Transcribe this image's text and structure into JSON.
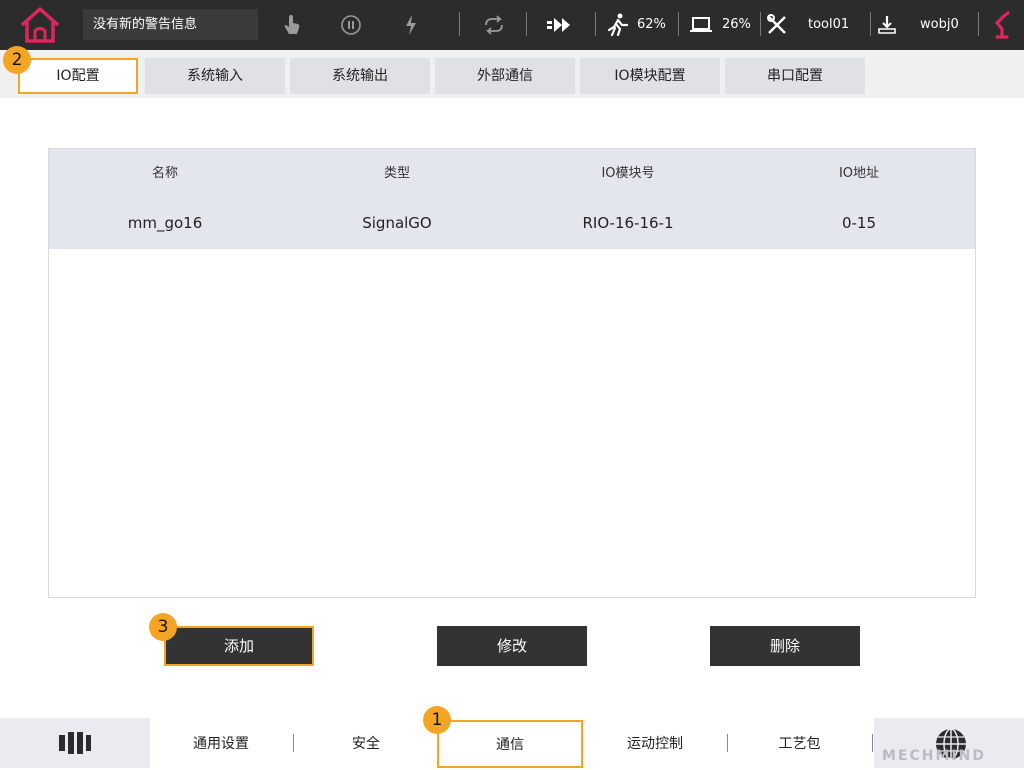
{
  "topbar": {
    "alarm_text": "没有新的警告信息",
    "speed_pct": "62%",
    "battery_pct": "26%",
    "tool": "tool01",
    "wobj": "wobj0"
  },
  "tabs": [
    {
      "label": "IO配置"
    },
    {
      "label": "系统输入"
    },
    {
      "label": "系统输出"
    },
    {
      "label": "外部通信"
    },
    {
      "label": "IO模块配置"
    },
    {
      "label": "串口配置"
    }
  ],
  "table": {
    "headers": [
      "名称",
      "类型",
      "IO模块号",
      "IO地址"
    ],
    "rows": [
      [
        "mm_go16",
        "SignalGO",
        "RIO-16-16-1",
        "0-15"
      ]
    ]
  },
  "buttons": {
    "add": "添加",
    "modify": "修改",
    "delete": "删除"
  },
  "bottom_nav": [
    {
      "label": "通用设置"
    },
    {
      "label": "安全"
    },
    {
      "label": "通信"
    },
    {
      "label": "运动控制"
    },
    {
      "label": "工艺包"
    }
  ],
  "badges": [
    "1",
    "2",
    "3"
  ],
  "watermark": "MECHMIND",
  "colors": {
    "accent": "#f5a524",
    "topbar": "#2c2c2c",
    "home_icon": "#e0245e",
    "button": "#333333"
  }
}
